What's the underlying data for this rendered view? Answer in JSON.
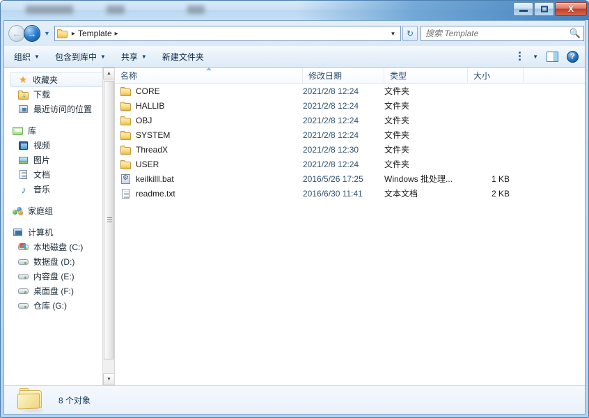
{
  "window": {
    "title_redacted": true,
    "controls": {
      "minimize": "—",
      "maximize": "□",
      "close": "X"
    }
  },
  "address_bar": {
    "back_button": "←",
    "forward_button": "→",
    "history_dropdown": "▼",
    "breadcrumb_folder_icon": "folder-icon",
    "separator": "▸",
    "path_segment": "Template",
    "path_dropdown": "▼",
    "refresh_button": "↻"
  },
  "search": {
    "placeholder": "搜索 Template",
    "value": "",
    "icon": "search-icon"
  },
  "toolbar": {
    "items": [
      {
        "label": "组织",
        "has_caret": true
      },
      {
        "label": "包含到库中",
        "has_caret": true
      },
      {
        "label": "共享",
        "has_caret": true
      },
      {
        "label": "新建文件夹",
        "has_caret": false
      }
    ],
    "view_caret": "▼",
    "view_icon": "view-options-icon",
    "preview_icon": "preview-pane-icon",
    "help_icon": "help-icon",
    "help_glyph": "?"
  },
  "sidebar": {
    "groups": [
      {
        "header": {
          "label": "收藏夹",
          "icon": "star-icon",
          "selected": true
        },
        "items": [
          {
            "label": "下载",
            "icon": "downloads-folder-icon"
          },
          {
            "label": "最近访问的位置",
            "icon": "recent-places-icon"
          }
        ]
      },
      {
        "header": {
          "label": "库",
          "icon": "library-icon",
          "selected": false
        },
        "items": [
          {
            "label": "视频",
            "icon": "video-icon"
          },
          {
            "label": "图片",
            "icon": "pictures-icon"
          },
          {
            "label": "文档",
            "icon": "documents-icon"
          },
          {
            "label": "音乐",
            "icon": "music-icon"
          }
        ]
      },
      {
        "header": {
          "label": "家庭组",
          "icon": "homegroup-icon",
          "selected": false
        },
        "items": []
      },
      {
        "header": {
          "label": "计算机",
          "icon": "computer-icon",
          "selected": false
        },
        "items": [
          {
            "label": "本地磁盘 (C:)",
            "icon": "system-drive-icon"
          },
          {
            "label": "数据盘 (D:)",
            "icon": "drive-icon"
          },
          {
            "label": "内容盘 (E:)",
            "icon": "drive-icon"
          },
          {
            "label": "桌面盘 (F:)",
            "icon": "drive-icon"
          },
          {
            "label": "仓库 (G:)",
            "icon": "drive-icon"
          }
        ]
      }
    ],
    "scrollbar": {
      "up": "▲",
      "down": "▼"
    }
  },
  "file_list": {
    "columns": [
      {
        "label": "名称",
        "sorted": true
      },
      {
        "label": "修改日期",
        "sorted": false
      },
      {
        "label": "类型",
        "sorted": false
      },
      {
        "label": "大小",
        "sorted": false
      },
      {
        "label": "",
        "sorted": false
      }
    ],
    "rows": [
      {
        "name": "CORE",
        "date": "2021/2/8 12:24",
        "type": "文件夹",
        "size": "",
        "icon": "folder-icon"
      },
      {
        "name": "HALLIB",
        "date": "2021/2/8 12:24",
        "type": "文件夹",
        "size": "",
        "icon": "folder-icon"
      },
      {
        "name": "OBJ",
        "date": "2021/2/8 12:24",
        "type": "文件夹",
        "size": "",
        "icon": "folder-icon"
      },
      {
        "name": "SYSTEM",
        "date": "2021/2/8 12:24",
        "type": "文件夹",
        "size": "",
        "icon": "folder-icon"
      },
      {
        "name": "ThreadX",
        "date": "2021/2/8 12:30",
        "type": "文件夹",
        "size": "",
        "icon": "folder-icon"
      },
      {
        "name": "USER",
        "date": "2021/2/8 12:24",
        "type": "文件夹",
        "size": "",
        "icon": "folder-icon"
      },
      {
        "name": "keilkilll.bat",
        "date": "2016/5/26 17:25",
        "type": "Windows 批处理...",
        "size": "1 KB",
        "icon": "bat-file-icon"
      },
      {
        "name": "readme.txt",
        "date": "2016/6/30 11:41",
        "type": "文本文档",
        "size": "2 KB",
        "icon": "text-file-icon"
      }
    ]
  },
  "status_bar": {
    "text": "8 个对象",
    "icon": "folder-large-icon"
  },
  "colors": {
    "accent": "#2a78c4",
    "close_red": "#c0402a",
    "folder_yellow": "#fcd87a",
    "title_glass": "#3c7cb9"
  }
}
